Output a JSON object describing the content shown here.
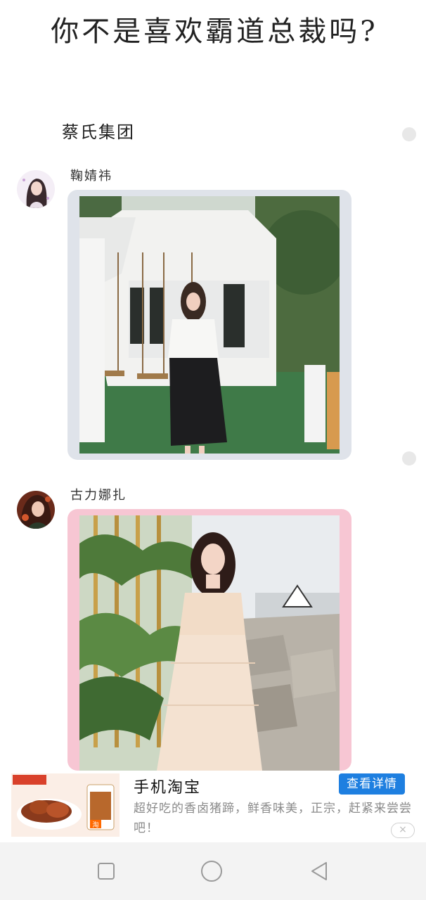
{
  "header": {
    "title": "你不是喜欢霸道总裁吗?",
    "group_name": "蔡氏集团"
  },
  "posts": [
    {
      "username": "鞠婧祎",
      "frame_color": "#dfe3ea"
    },
    {
      "username": "古力娜扎",
      "frame_color": "#f7c6d3"
    }
  ],
  "ad": {
    "thumb_text": "淘",
    "title": "手机淘宝",
    "cta_label": "查看详情",
    "description": "超好吃的香卤猪蹄，鲜香味美，正宗，赶紧来尝尝吧！",
    "close_label": "×"
  },
  "navbar": {
    "buttons": [
      "square-icon",
      "circle-icon",
      "triangle-back-icon"
    ]
  }
}
